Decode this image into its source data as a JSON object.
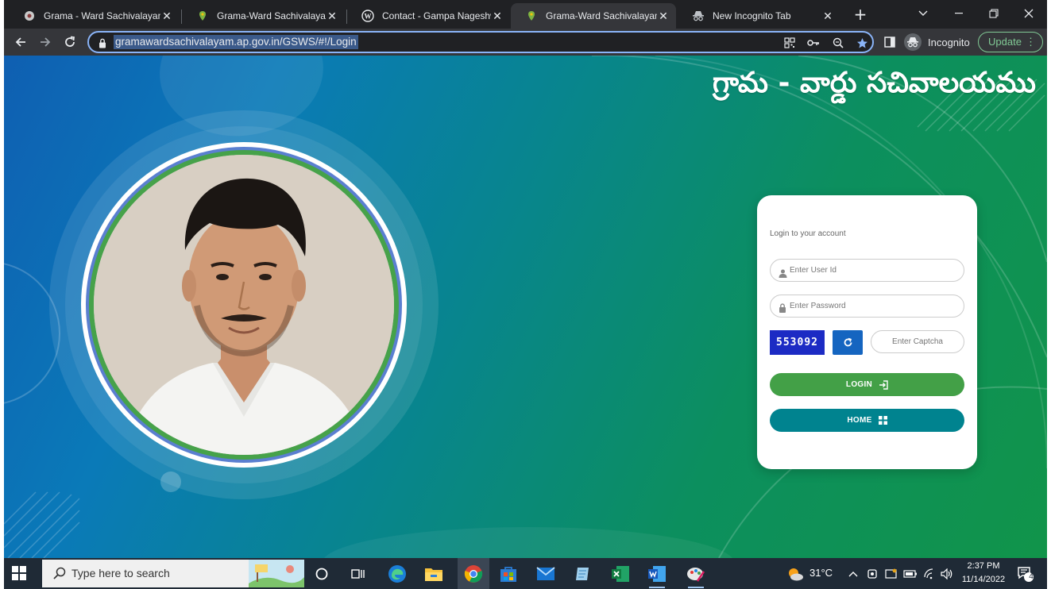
{
  "browser": {
    "tabs": [
      {
        "title": "Grama - Ward Sachivalayam",
        "favicon": "gear-favicon",
        "active": false
      },
      {
        "title": "Grama-Ward Sachivalayam",
        "favicon": "map-pin-favicon",
        "active": false
      },
      {
        "title": "Contact - Gampa Nageshwar",
        "favicon": "wordpress-favicon",
        "active": false
      },
      {
        "title": "Grama-Ward Sachivalayam",
        "favicon": "map-pin-favicon",
        "active": true
      },
      {
        "title": "New Incognito Tab",
        "favicon": "incognito-favicon",
        "active": false
      }
    ],
    "close_glyph": "✕",
    "url": "gramawardsachivalayam.ap.gov.in/GSWS/#!/Login",
    "profile_label": "Incognito",
    "update_label": "Update"
  },
  "page": {
    "brand_title": "గ్రామ - వార్డు సచివాలయము",
    "login": {
      "heading": "Login to your account",
      "user_placeholder": "Enter User Id",
      "password_placeholder": "Enter Password",
      "captcha_code": "553092",
      "captcha_placeholder": "Enter Captcha",
      "login_label": "LOGIN",
      "home_label": "HOME"
    }
  },
  "taskbar": {
    "search_placeholder": "Type here to search",
    "weather": "31°C",
    "time": "2:37 PM",
    "date": "11/14/2022",
    "notification_count": "4"
  },
  "colors": {
    "login_button": "#43a047",
    "home_button": "#00838f",
    "refresh_button": "#1565c0",
    "captcha_bg": "#1c2bc4"
  }
}
